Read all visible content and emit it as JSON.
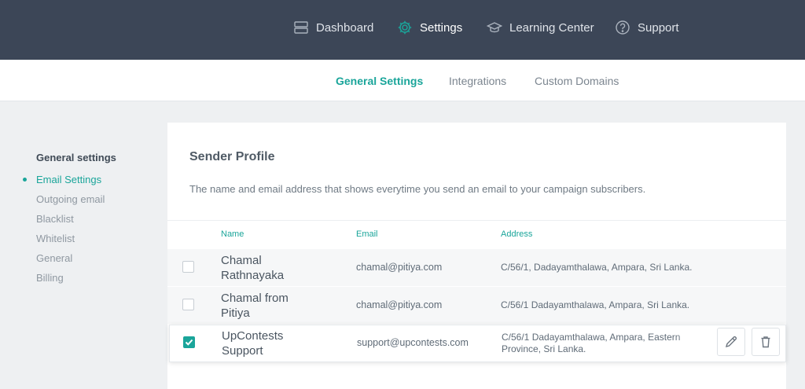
{
  "nav": {
    "items": [
      {
        "label": "Dashboard",
        "icon": "dashboard-icon"
      },
      {
        "label": "Settings",
        "icon": "gear-icon"
      },
      {
        "label": "Learning Center",
        "icon": "graduation-cap-icon"
      },
      {
        "label": "Support",
        "icon": "help-circle-icon"
      }
    ]
  },
  "tabs": [
    {
      "label": "General Settings",
      "active": true
    },
    {
      "label": "Integrations",
      "active": false
    },
    {
      "label": "Custom Domains",
      "active": false
    }
  ],
  "sidebar": {
    "heading": "General settings",
    "items": [
      {
        "label": "Email Settings",
        "active": true
      },
      {
        "label": "Outgoing email",
        "active": false
      },
      {
        "label": "Blacklist",
        "active": false
      },
      {
        "label": "Whitelist",
        "active": false
      },
      {
        "label": "General",
        "active": false
      },
      {
        "label": "Billing",
        "active": false
      }
    ]
  },
  "card": {
    "title": "Sender Profile",
    "description": "The name and email address that shows everytime you send an email to your campaign subscribers.",
    "columns": {
      "name": "Name",
      "email": "Email",
      "address": "Address"
    },
    "rows": [
      {
        "name": "Chamal Rathnayaka",
        "email": "chamal@pitiya.com",
        "address": "C/56/1, Dadayamthalawa, Ampara, Sri Lanka.",
        "checked": false
      },
      {
        "name": "Chamal from Pitiya",
        "email": "chamal@pitiya.com",
        "address": "C/56/1 Dadayamthalawa, Ampara, Sri Lanka.",
        "checked": false
      },
      {
        "name": "UpContests Support",
        "email": "support@upcontests.com",
        "address": "C/56/1 Dadayamthalawa, Ampara, Eastern Province, Sri Lanka.",
        "checked": true
      }
    ]
  },
  "colors": {
    "accent": "#1aa59a",
    "topbar": "#3c4657"
  }
}
